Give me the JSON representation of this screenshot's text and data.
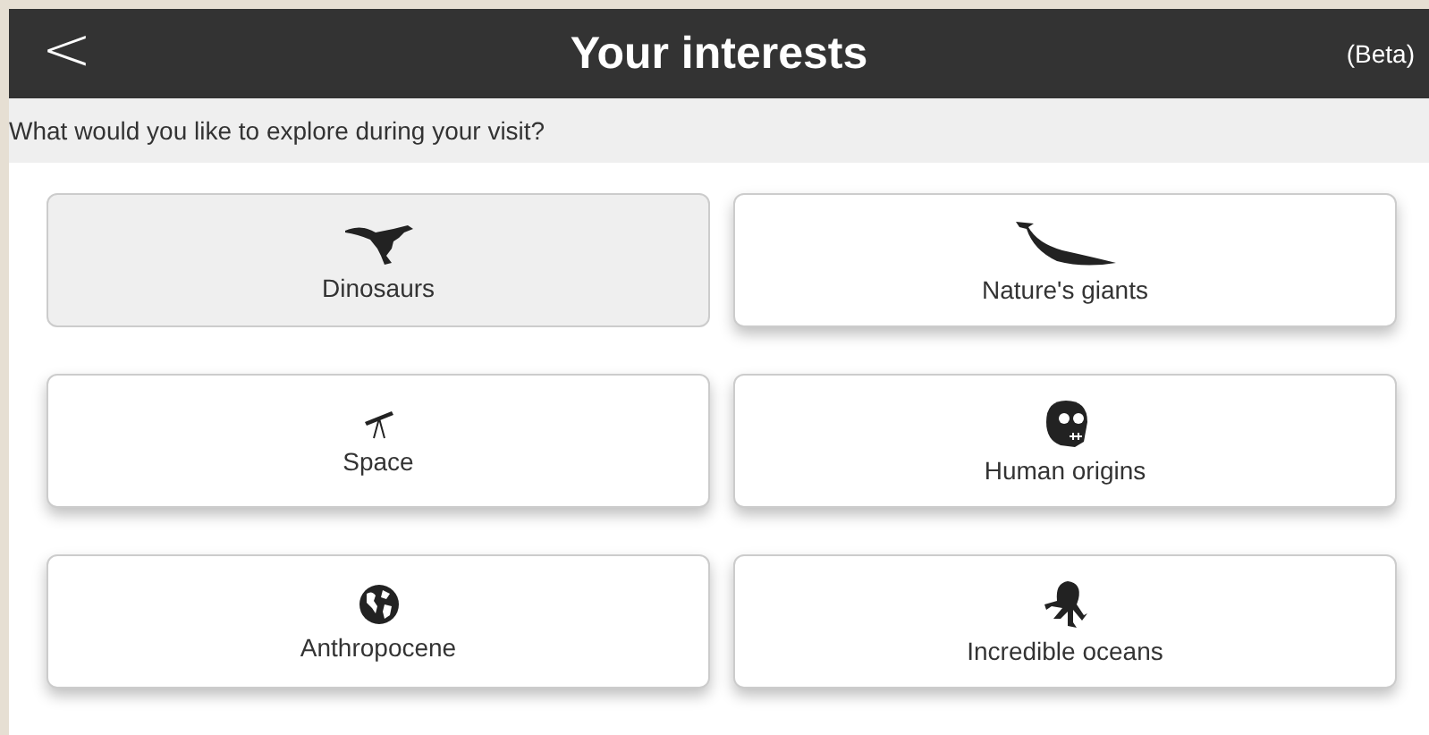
{
  "header": {
    "back": "<",
    "title": "Your interests",
    "badge": "(Beta)"
  },
  "prompt": "What would you like to explore during your visit?",
  "interests": [
    {
      "label": "Dinosaurs",
      "selected": true
    },
    {
      "label": "Nature's giants",
      "selected": false
    },
    {
      "label": "Space",
      "selected": false
    },
    {
      "label": "Human origins",
      "selected": false
    },
    {
      "label": "Anthropocene",
      "selected": false
    },
    {
      "label": "Incredible oceans",
      "selected": false
    }
  ]
}
